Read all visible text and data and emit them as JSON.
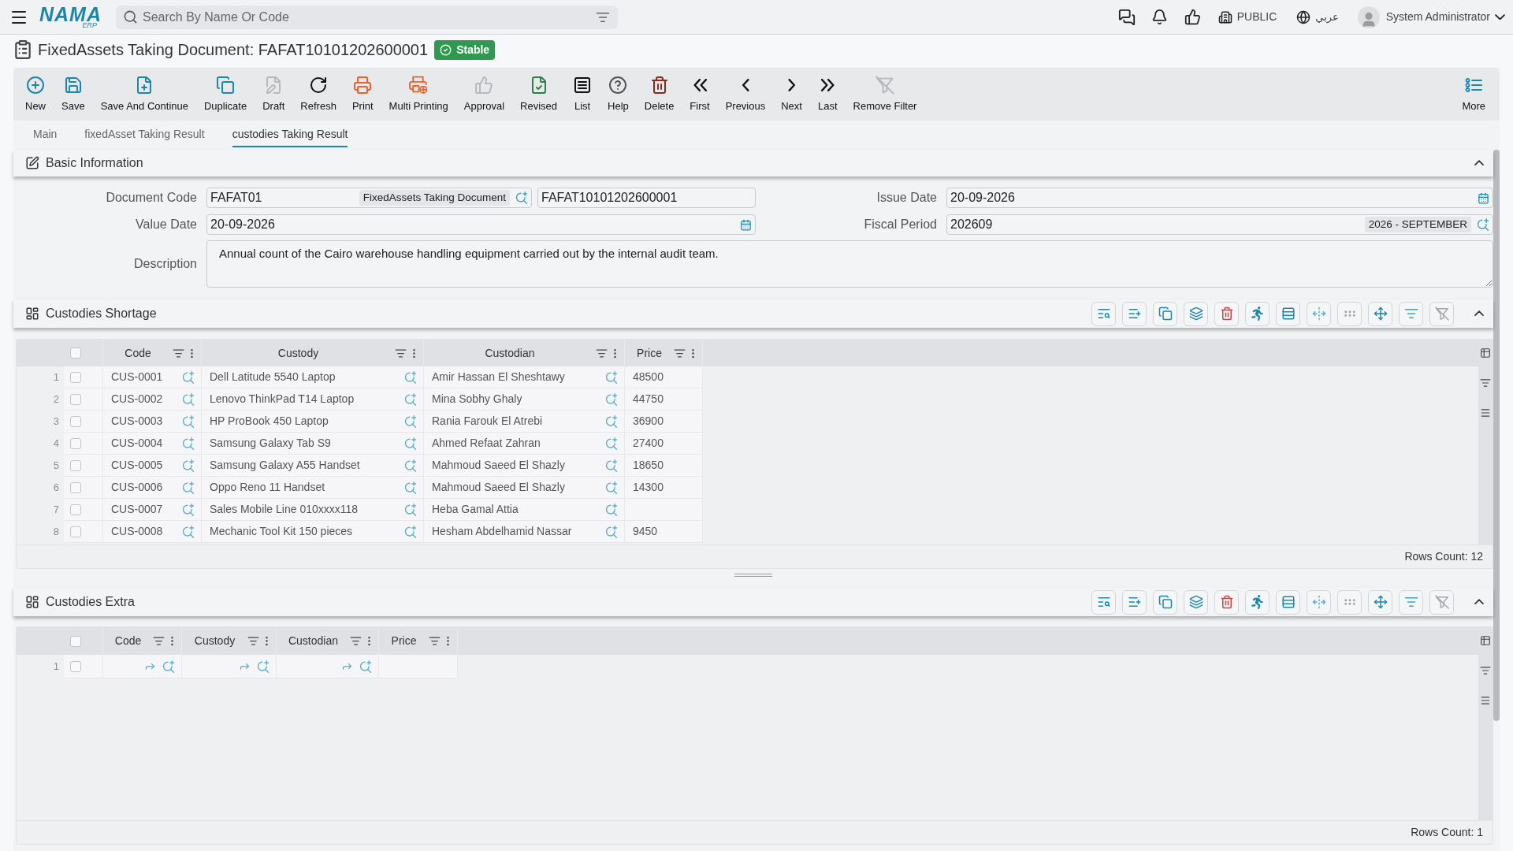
{
  "top_bar": {
    "logo": {
      "name": "NAMA",
      "suffix": "ERP"
    },
    "search": {
      "placeholder": "Search By Name Or Code"
    },
    "company": "PUBLIC",
    "language": "عربي",
    "user": "System Administrator"
  },
  "header": {
    "title": "FixedAssets Taking Document: FAFAT10101202600001",
    "status": "Stable"
  },
  "toolbar": {
    "buttons": [
      {
        "label": "New",
        "disabled": false
      },
      {
        "label": "Save",
        "disabled": false
      },
      {
        "label": "Save And Continue",
        "disabled": false
      },
      {
        "label": "Duplicate",
        "disabled": false
      },
      {
        "label": "Draft",
        "disabled": true
      },
      {
        "label": "Refresh",
        "disabled": false
      },
      {
        "label": "Print",
        "disabled": false
      },
      {
        "label": "Multi Printing",
        "disabled": false
      },
      {
        "label": "Approval",
        "disabled": true
      },
      {
        "label": "Revised",
        "disabled": false
      },
      {
        "label": "List",
        "disabled": false
      },
      {
        "label": "Help",
        "disabled": false
      },
      {
        "label": "Delete",
        "disabled": false
      },
      {
        "label": "First",
        "disabled": false
      },
      {
        "label": "Previous",
        "disabled": false
      },
      {
        "label": "Next",
        "disabled": false
      },
      {
        "label": "Last",
        "disabled": false
      },
      {
        "label": "Remove Filter",
        "disabled": true
      }
    ],
    "more": {
      "label": "More"
    }
  },
  "tabs": [
    {
      "label": "Main",
      "selected": false
    },
    {
      "label": "fixedAsset Taking Result",
      "selected": false
    },
    {
      "label": "custodies Taking Result",
      "selected": true
    }
  ],
  "basic_information": {
    "title": "Basic Information",
    "expanded": true,
    "document_code": {
      "label": "Document Code",
      "code": "FAFAT01",
      "type": "FixedAssets Taking Document",
      "number": "FAFAT10101202600001"
    },
    "issue_date": {
      "label": "Issue Date",
      "value": "20-09-2026"
    },
    "value_date": {
      "label": "Value Date",
      "value": "20-09-2026"
    },
    "fiscal_period": {
      "label": "Fiscal Period",
      "value": "202609",
      "period": "2026 - SEPTEMBER"
    },
    "description": {
      "label": "Description",
      "value": "Annual count of the Cairo warehouse handling equipment carried out by the internal audit team."
    }
  },
  "custodies_shortage": {
    "title": "Custodies Shortage",
    "expanded": true,
    "actions": [
      {
        "disabled": false
      },
      {
        "disabled": false
      },
      {
        "disabled": false
      },
      {
        "disabled": false
      },
      {
        "disabled": false
      },
      {
        "disabled": false
      },
      {
        "disabled": false
      },
      {
        "disabled": false
      },
      {
        "disabled": true
      },
      {
        "disabled": false
      },
      {
        "disabled": false
      },
      {
        "disabled": true
      }
    ],
    "select_all": {
      "checked": false
    },
    "columns": [
      {
        "label": "Code",
        "kind": "lookup"
      },
      {
        "label": "Custody",
        "kind": "lookup"
      },
      {
        "label": "Custodian",
        "kind": "lookup"
      },
      {
        "label": "Price",
        "kind": "number"
      }
    ],
    "rows": [
      {
        "number": "1",
        "checked": false,
        "code": "CUS-0001",
        "custody": "Dell Latitude 5540 Laptop",
        "custodian": "Amir Hassan El Sheshtawy",
        "price": "48500"
      },
      {
        "number": "2",
        "checked": false,
        "code": "CUS-0002",
        "custody": "Lenovo ThinkPad T14 Laptop",
        "custodian": "Mina Sobhy Ghaly",
        "price": "44750"
      },
      {
        "number": "3",
        "checked": false,
        "code": "CUS-0003",
        "custody": "HP ProBook 450 Laptop",
        "custodian": "Rania Farouk El Atrebi",
        "price": "36900"
      },
      {
        "number": "4",
        "checked": false,
        "code": "CUS-0004",
        "custody": "Samsung Galaxy Tab S9",
        "custodian": "Ahmed Refaat Zahran",
        "price": "27400"
      },
      {
        "number": "5",
        "checked": false,
        "code": "CUS-0005",
        "custody": "Samsung Galaxy A55 Handset",
        "custodian": "Mahmoud Saeed El Shazly",
        "price": "18650"
      },
      {
        "number": "6",
        "checked": false,
        "code": "CUS-0006",
        "custody": "Oppo Reno 11 Handset",
        "custodian": "Mahmoud Saeed El Shazly",
        "price": "14300"
      },
      {
        "number": "7",
        "checked": false,
        "code": "CUS-0007",
        "custody": "Sales Mobile Line 010xxxx118",
        "custodian": "Heba Gamal Attia"
      },
      {
        "number": "8",
        "checked": false,
        "code": "CUS-0008",
        "custody": "Mechanic Tool Kit 150 pieces",
        "custodian": "Hesham Abdelhamid Nassar",
        "price": "9450"
      }
    ],
    "rows_count": "Rows Count: 12"
  },
  "custodies_extra": {
    "title": "Custodies Extra",
    "expanded": true,
    "actions": [
      {
        "disabled": false
      },
      {
        "disabled": false
      },
      {
        "disabled": false
      },
      {
        "disabled": false
      },
      {
        "disabled": false
      },
      {
        "disabled": false
      },
      {
        "disabled": false
      },
      {
        "disabled": false
      },
      {
        "disabled": true
      },
      {
        "disabled": false
      },
      {
        "disabled": false
      },
      {
        "disabled": true
      }
    ],
    "select_all": {
      "checked": false
    },
    "columns": [
      {
        "label": "Code",
        "kind": "lookup"
      },
      {
        "label": "Custody",
        "kind": "lookup"
      },
      {
        "label": "Custodian",
        "kind": "lookup"
      },
      {
        "label": "Price",
        "kind": "number"
      }
    ],
    "rows": [
      {
        "number": "1",
        "checked": false
      }
    ],
    "rows_count": "Rows Count: 1"
  }
}
